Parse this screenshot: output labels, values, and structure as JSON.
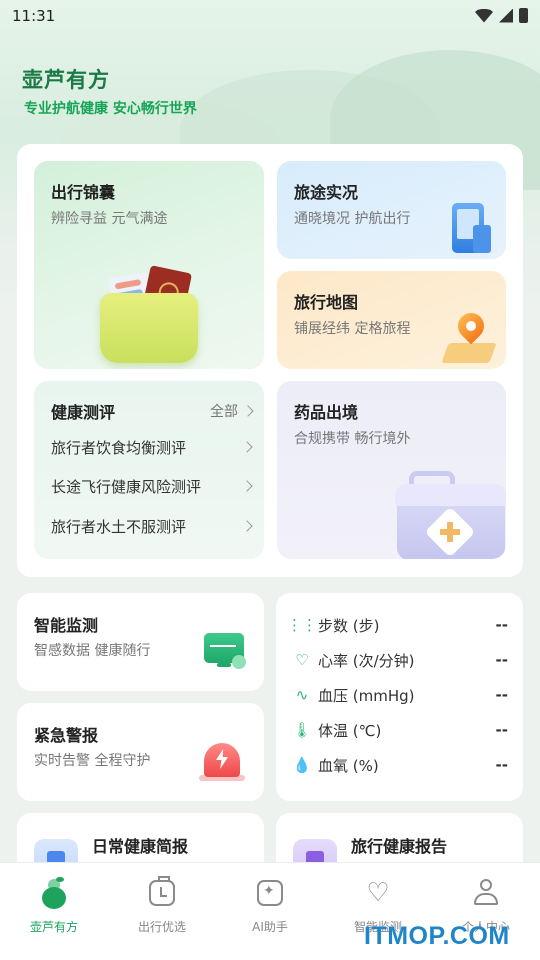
{
  "status": {
    "time": "11:31"
  },
  "header": {
    "title": "壶芦有方",
    "subtitle": "专业护航健康 安心畅行世界"
  },
  "tiles": {
    "jinnang": {
      "title": "出行锦囊",
      "sub": "辨险寻益 元气满途"
    },
    "shikuang": {
      "title": "旅途实况",
      "sub": "通晓境况 护航出行"
    },
    "ditu": {
      "title": "旅行地图",
      "sub": "铺展经纬 定格旅程"
    },
    "cepin": {
      "title": "健康测评",
      "all": "全部",
      "items": [
        "旅行者饮食均衡测评",
        "长途飞行健康风险测评",
        "旅行者水土不服测评"
      ]
    },
    "yaopin": {
      "title": "药品出境",
      "sub": "合规携带 畅行境外"
    }
  },
  "cards": {
    "monitor": {
      "title": "智能监测",
      "sub": "智感数据 健康随行"
    },
    "alarm": {
      "title": "紧急警报",
      "sub": "实时告警 全程守护"
    },
    "daily": {
      "title": "日常健康简报"
    },
    "travel_report": {
      "title": "旅行健康报告"
    }
  },
  "vitals": [
    {
      "label": "步数 (步)",
      "value": "--",
      "icon": "footprint-icon"
    },
    {
      "label": "心率 (次/分钟)",
      "value": "--",
      "icon": "heart-rate-icon"
    },
    {
      "label": "血压 (mmHg)",
      "value": "--",
      "icon": "pulse-icon"
    },
    {
      "label": "体温 (℃)",
      "value": "--",
      "icon": "thermometer-icon"
    },
    {
      "label": "血氧 (%)",
      "value": "--",
      "icon": "drop-icon"
    }
  ],
  "tabbar": {
    "items": [
      {
        "label": "壶芦有方",
        "active": true
      },
      {
        "label": "出行优选",
        "active": false
      },
      {
        "label": "AI助手",
        "active": false
      },
      {
        "label": "智能监测",
        "active": false
      },
      {
        "label": "个人中心",
        "active": false
      }
    ]
  },
  "watermark": "ITMOP.COM",
  "colors": {
    "brand": "#1b7a45",
    "accent": "#1ea35e",
    "subtitle": "#17a657"
  }
}
